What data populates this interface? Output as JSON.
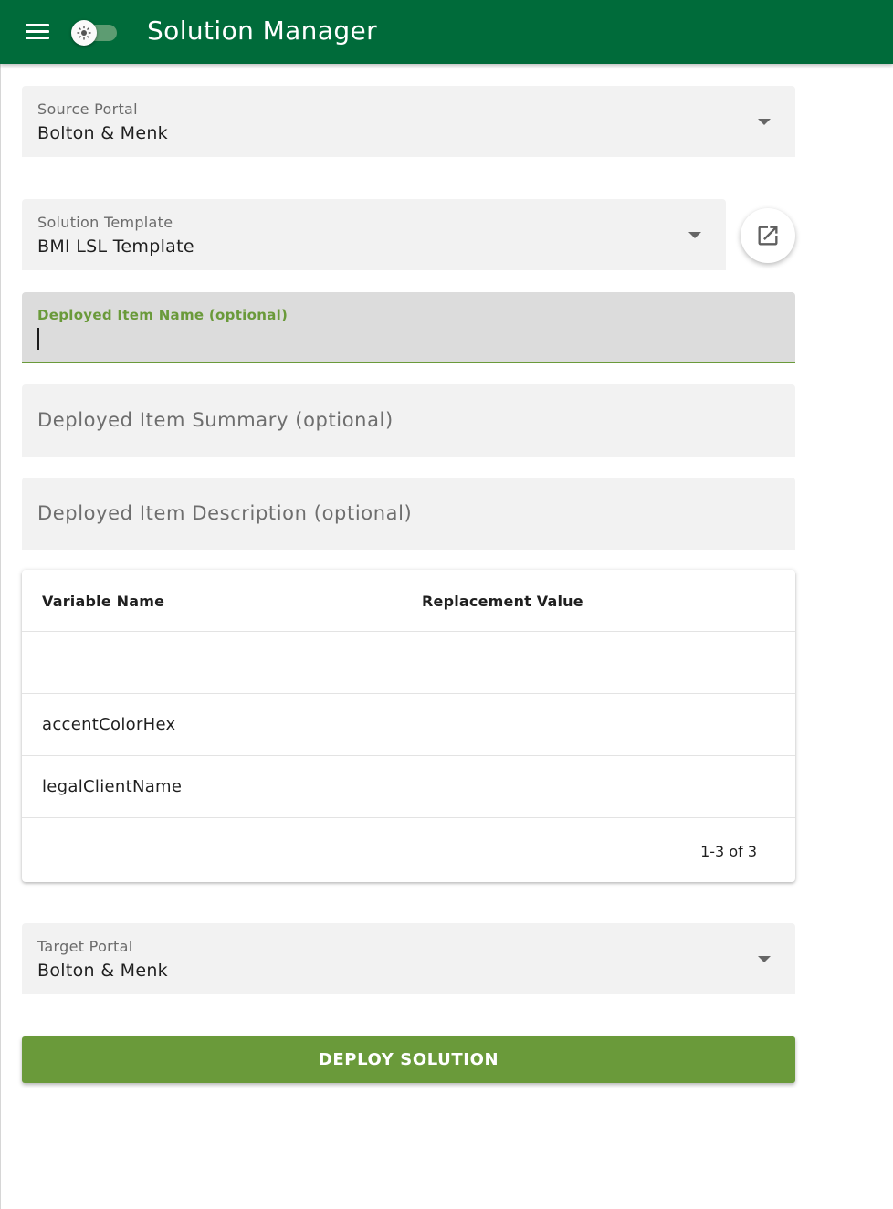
{
  "app": {
    "title": "Solution Manager",
    "colors": {
      "header": "#006b3a",
      "accent": "#6a9a3a"
    }
  },
  "header": {
    "menu_icon": "hamburger-menu-icon",
    "theme_toggle_icon": "sun-icon",
    "theme_toggle_state": "off"
  },
  "form": {
    "source_portal": {
      "label": "Source Portal",
      "value": "Bolton & Menk"
    },
    "solution_template": {
      "label": "Solution Template",
      "value": "BMI LSL Template",
      "open_icon": "open-in-new-icon"
    },
    "deployed_item_name": {
      "label": "Deployed Item Name (optional)",
      "value": ""
    },
    "deployed_item_summary": {
      "placeholder": "Deployed Item Summary (optional)"
    },
    "deployed_item_description": {
      "placeholder": "Deployed Item Description (optional)"
    },
    "target_portal": {
      "label": "Target Portal",
      "value": "Bolton & Menk"
    }
  },
  "variables_table": {
    "columns": [
      "Variable Name",
      "Replacement Value"
    ],
    "rows": [
      {
        "name": "",
        "value": ""
      },
      {
        "name": "accentColorHex",
        "value": ""
      },
      {
        "name": "legalClientName",
        "value": ""
      }
    ],
    "pagination": "1-3 of 3"
  },
  "actions": {
    "deploy_label": "DEPLOY SOLUTION"
  }
}
